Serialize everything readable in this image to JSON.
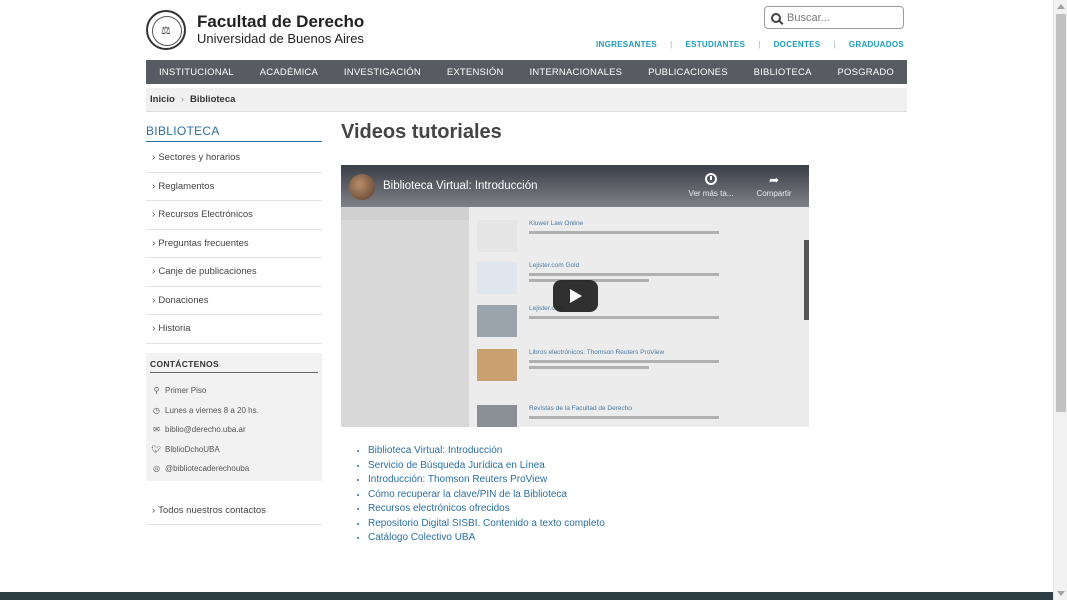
{
  "header": {
    "title": "Facultad de Derecho",
    "subtitle": "Universidad de Buenos Aires",
    "search_placeholder": "Buscar..."
  },
  "quick_links": [
    "INGRESANTES",
    "ESTUDIANTES",
    "DOCENTES",
    "GRADUADOS"
  ],
  "nav": [
    "INSTITUCIONAL",
    "ACADÉMICA",
    "INVESTIGACIÓN",
    "EXTENSIÓN",
    "INTERNACIONALES",
    "PUBLICACIONES",
    "BIBLIOTECA",
    "POSGRADO"
  ],
  "breadcrumb": [
    "Inicio",
    "Biblioteca"
  ],
  "sidebar": {
    "title": "BIBLIOTECA",
    "items": [
      "Sectores y horarios",
      "Reglamentos",
      "Recursos Electrónicos",
      "Preguntas frecuentes",
      "Canje de publicaciones",
      "Donaciones",
      "Historia"
    ],
    "contact": {
      "title": "CONTÁCTENOS",
      "rows": [
        {
          "icon": "map-marker-icon",
          "text": "Primer Piso"
        },
        {
          "icon": "clock-icon",
          "text": "Lunes a viernes 8 a 20 hs."
        },
        {
          "icon": "envelope-icon",
          "text": "biblio@derecho.uba.ar"
        },
        {
          "icon": "twitter-icon",
          "text": "BiblioDchoUBA"
        },
        {
          "icon": "instagram-icon",
          "text": "@bibliotecaderechouba"
        }
      ]
    },
    "all_contacts": "Todos nuestros contactos"
  },
  "main": {
    "title": "Videos tutoriales",
    "video": {
      "title": "Biblioteca Virtual: Introducción",
      "watch_later": "Ver más ta...",
      "share": "Compartir",
      "rows": [
        "Kluwer Law Online",
        "Lejister.com Gold",
        "Lejister.com",
        "Libros electrónicos: Thomson Reuters ProView",
        "Revistas de la Facultad de Derecho"
      ]
    },
    "links": [
      "Biblioteca Virtual: Introducción",
      "Servicio de Búsqueda Jurídica en Línea",
      "Introducción: Thomson Reuters ProView",
      "Cómo recuperar la clave/PIN de la Biblioteca",
      "Recursos electrónicos ofrecidos",
      "Repositorio Digital SISBI. Contenido a texto completo",
      "Catálogo Colectivo UBA"
    ]
  },
  "colors": {
    "nav_bg": "#585b62",
    "link": "#2c6fa0",
    "quick_link": "#1a9bbd",
    "footer": "#2f3d45"
  }
}
